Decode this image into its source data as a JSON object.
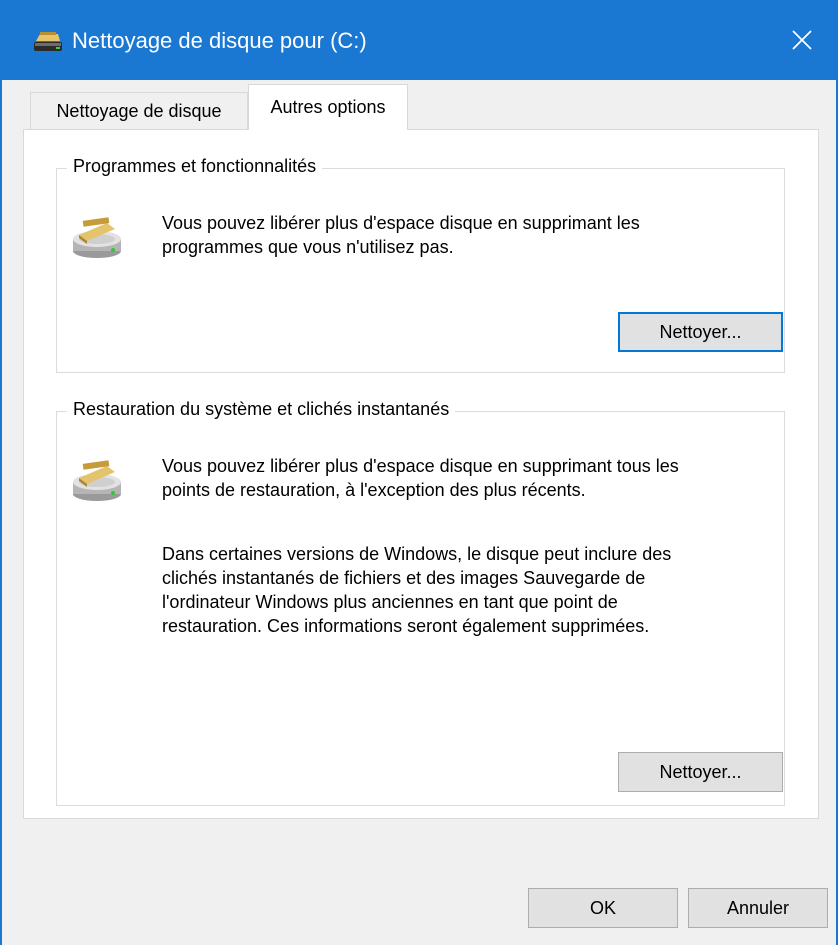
{
  "window": {
    "title": "Nettoyage de disque pour  (C:)",
    "close_icon": "close-icon",
    "accent_color": "#1a77d2"
  },
  "tabs": [
    {
      "label": "Nettoyage de disque",
      "active": false
    },
    {
      "label": "Autres options",
      "active": true
    }
  ],
  "programs_group": {
    "legend": "Programmes et fonctionnalités",
    "icon": "disk-cleanup-icon",
    "text_line1": "Vous pouvez libérer plus d'espace disque en supprimant les",
    "text_line2": "programmes que vous n'utilisez pas.",
    "button_label": "Nettoyer..."
  },
  "restore_group": {
    "legend": "Restauration du système et clichés instantanés",
    "icon": "disk-cleanup-icon",
    "text1_line1": "Vous pouvez libérer plus d'espace disque en supprimant tous les",
    "text1_line2": "points de restauration, à l'exception des plus récents.",
    "text2_line1": "Dans certaines versions de Windows, le disque peut inclure des",
    "text2_line2": "clichés instantanés de fichiers et des images Sauvegarde de",
    "text2_line3": "l'ordinateur Windows plus anciennes en tant que point de",
    "text2_line4": "restauration. Ces informations seront également supprimées.",
    "button_label": "Nettoyer..."
  },
  "footer": {
    "ok_label": "OK",
    "cancel_label": "Annuler"
  }
}
